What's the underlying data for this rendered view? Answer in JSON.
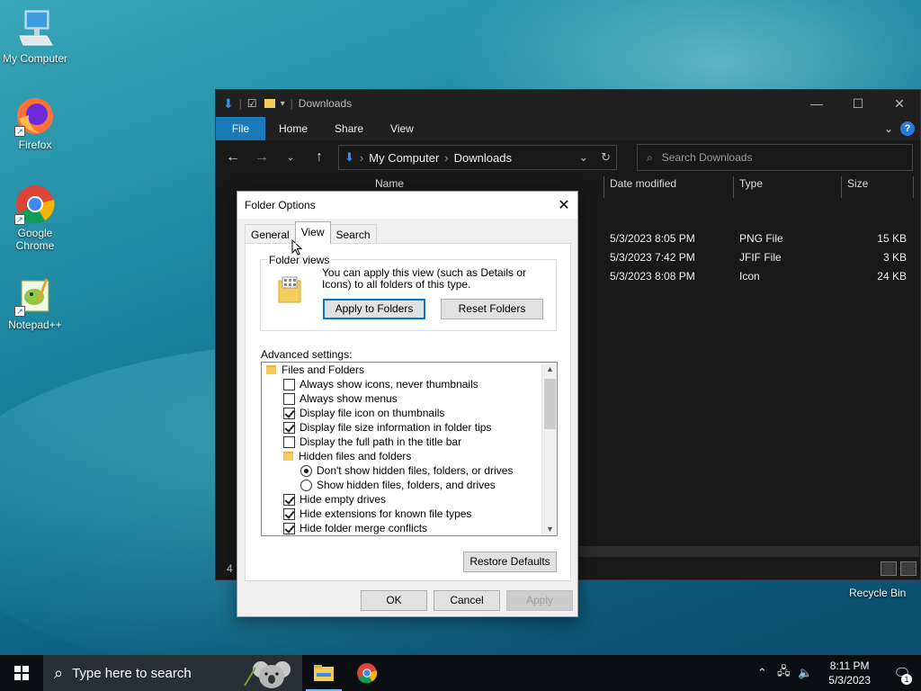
{
  "desktop": {
    "icons": [
      {
        "label": "My Computer"
      },
      {
        "label": "Firefox"
      },
      {
        "label": "Google Chrome"
      },
      {
        "label": "Notepad++"
      }
    ],
    "recycle_bin": "Recycle Bin"
  },
  "explorer": {
    "title": "Downloads",
    "ribbon_tabs": [
      "File",
      "Home",
      "Share",
      "View"
    ],
    "breadcrumb": [
      "My Computer",
      "Downloads"
    ],
    "search_placeholder": "Search Downloads",
    "columns": [
      "Name",
      "Date modified",
      "Type",
      "Size"
    ],
    "files": [
      {
        "date": "5/3/2023 8:05 PM",
        "type": "PNG File",
        "size": "15 KB"
      },
      {
        "date": "5/3/2023 7:42 PM",
        "type": "JFIF File",
        "size": "3 KB"
      },
      {
        "date": "5/3/2023 8:08 PM",
        "type": "Icon",
        "size": "24 KB"
      }
    ],
    "status_count": "4"
  },
  "dialog": {
    "title": "Folder Options",
    "tabs": [
      "General",
      "View",
      "Search"
    ],
    "active_tab": "View",
    "folder_views": {
      "label": "Folder views",
      "description": "You can apply this view (such as Details or Icons) to all folders of this type.",
      "apply_button": "Apply to Folders",
      "reset_button": "Reset Folders"
    },
    "advanced_label": "Advanced settings:",
    "settings": [
      {
        "kind": "folder",
        "label": "Files and Folders",
        "indent": 0
      },
      {
        "kind": "check",
        "checked": false,
        "label": "Always show icons, never thumbnails",
        "indent": 1
      },
      {
        "kind": "check",
        "checked": false,
        "label": "Always show menus",
        "indent": 1
      },
      {
        "kind": "check",
        "checked": true,
        "label": "Display file icon on thumbnails",
        "indent": 1
      },
      {
        "kind": "check",
        "checked": true,
        "label": "Display file size information in folder tips",
        "indent": 1
      },
      {
        "kind": "check",
        "checked": false,
        "label": "Display the full path in the title bar",
        "indent": 1
      },
      {
        "kind": "folder",
        "label": "Hidden files and folders",
        "indent": 1
      },
      {
        "kind": "radio",
        "checked": true,
        "label": "Don't show hidden files, folders, or drives",
        "indent": 2
      },
      {
        "kind": "radio",
        "checked": false,
        "label": "Show hidden files, folders, and drives",
        "indent": 2
      },
      {
        "kind": "check",
        "checked": true,
        "label": "Hide empty drives",
        "indent": 1
      },
      {
        "kind": "check",
        "checked": true,
        "label": "Hide extensions for known file types",
        "indent": 1
      },
      {
        "kind": "check",
        "checked": true,
        "label": "Hide folder merge conflicts",
        "indent": 1
      }
    ],
    "restore_defaults": "Restore Defaults",
    "ok": "OK",
    "cancel": "Cancel",
    "apply": "Apply"
  },
  "taskbar": {
    "search_placeholder": "Type here to search",
    "time": "8:11 PM",
    "date": "5/3/2023",
    "notification_count": "1"
  }
}
